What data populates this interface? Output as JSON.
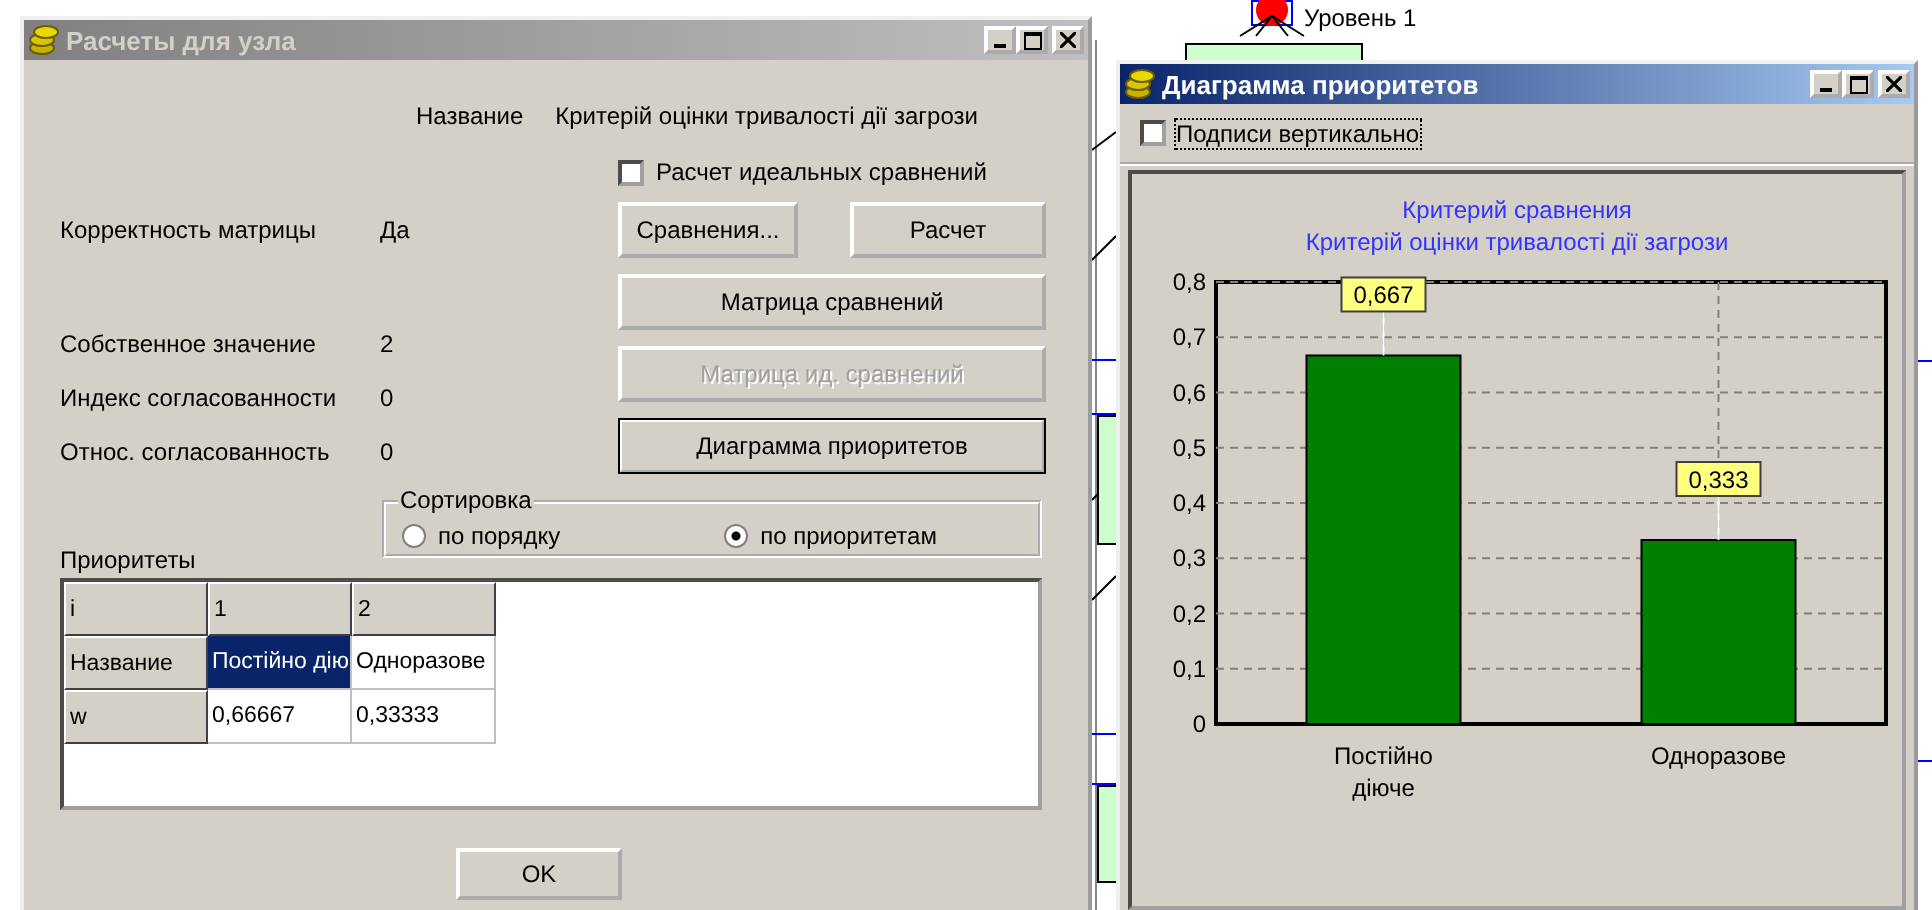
{
  "background_diagram": {
    "level_label": "Уровень 1"
  },
  "node_window": {
    "title": "Расчеты для узла",
    "active": false,
    "name_label": "Название",
    "name_value": "Критерій оцінки тривалості дії загрози",
    "ideal_checkbox": {
      "label": "Расчет идеальных сравнений",
      "checked": false
    },
    "stats": [
      {
        "label": "Корректность матрицы",
        "value": "Да"
      },
      {
        "label": "Собственное значение",
        "value": "2"
      },
      {
        "label": "Индекс согласованности",
        "value": "0"
      },
      {
        "label": "Относ. согласованность",
        "value": "0"
      }
    ],
    "buttons": [
      {
        "label": "Сравнения...",
        "disabled": false,
        "default": false
      },
      {
        "label": "Расчет",
        "disabled": false,
        "default": false
      },
      {
        "label": "Матрица сравнений",
        "disabled": false,
        "default": false
      },
      {
        "label": "Матрица ид. сравнений",
        "disabled": true,
        "default": false
      },
      {
        "label": "Диаграмма приоритетов",
        "disabled": false,
        "default": true
      }
    ],
    "sorting": {
      "title": "Сортировка",
      "options": [
        {
          "label": "по порядку",
          "selected": false
        },
        {
          "label": "по приоритетам",
          "selected": true
        }
      ]
    },
    "priorities_label": "Приоритеты",
    "grid": {
      "header": [
        "i",
        "1",
        "2"
      ],
      "rows": [
        {
          "header": "Название",
          "cells": [
            {
              "text": "Постійно дію",
              "selected": true
            },
            {
              "text": "Одноразове",
              "selected": false
            }
          ]
        },
        {
          "header": "w",
          "cells": [
            {
              "text": "0,66667",
              "selected": false
            },
            {
              "text": "0,33333",
              "selected": false
            }
          ]
        }
      ]
    },
    "ok_button": "OK"
  },
  "chart_window": {
    "title": "Диаграмма приоритетов",
    "active": true,
    "vertical_labels": {
      "label": "Подписи вертикально",
      "checked": false
    },
    "chart_title": "Критерий сравнения",
    "chart_subtitle": "Критерій оцінки тривалості дії загрози",
    "chart_data": {
      "type": "bar",
      "categories": [
        "Постійно діюче",
        "Одноразове"
      ],
      "values": [
        0.667,
        0.333
      ],
      "ylim": [
        0,
        0.8
      ],
      "yticks": [
        {
          "value": 0,
          "label": "0"
        },
        {
          "value": 0.1,
          "label": "0,1"
        },
        {
          "value": 0.2,
          "label": "0,2"
        },
        {
          "value": 0.3,
          "label": "0,3"
        },
        {
          "value": 0.4,
          "label": "0,4"
        },
        {
          "value": 0.5,
          "label": "0,5"
        },
        {
          "value": 0.6,
          "label": "0,6"
        },
        {
          "value": 0.7,
          "label": "0,7"
        },
        {
          "value": 0.8,
          "label": "0,8"
        }
      ],
      "grid": true,
      "data_labels": true,
      "value_labels": [
        "0,667",
        "0,333"
      ]
    }
  }
}
